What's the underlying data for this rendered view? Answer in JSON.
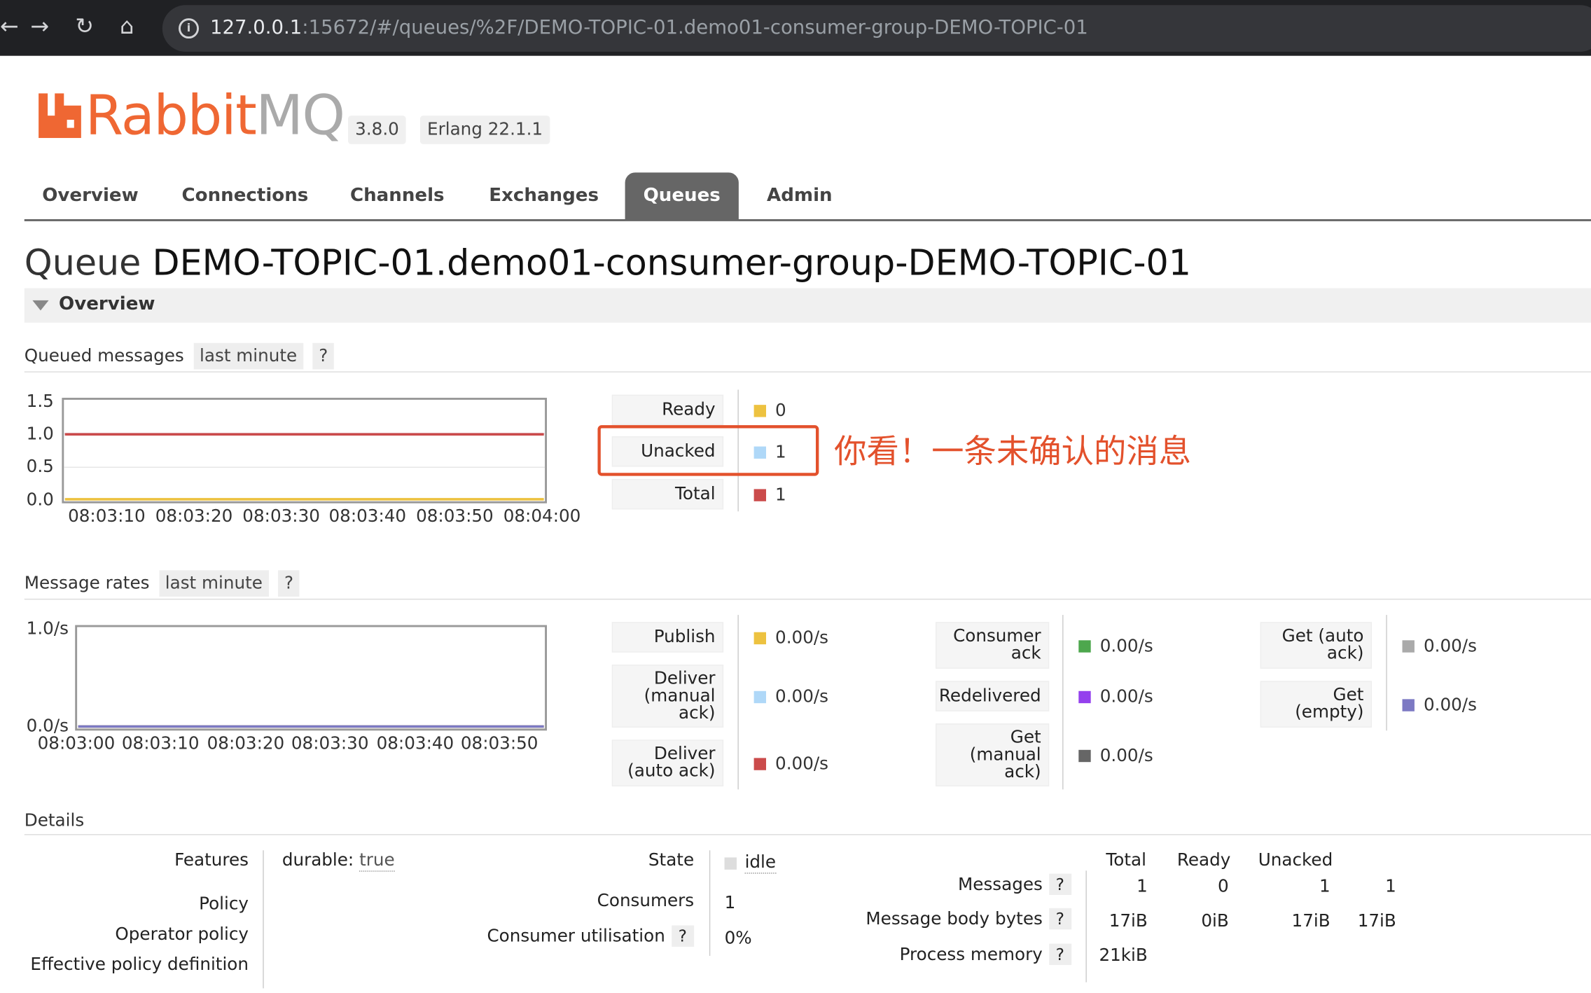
{
  "browser": {
    "url_host": "127.0.0.1",
    "url_rest": ":15672/#/queues/%2F/DEMO-TOPIC-01.demo01-consumer-group-DEMO-TOPIC-01"
  },
  "header": {
    "logo_rabbit": "Rabbit",
    "logo_mq": "MQ",
    "version": "3.8.0",
    "erlang": "Erlang 22.1.1"
  },
  "tabs": [
    "Overview",
    "Connections",
    "Channels",
    "Exchanges",
    "Queues",
    "Admin"
  ],
  "active_tab": "Queues",
  "page": {
    "title_prefix": "Queue",
    "queue_name": "DEMO-TOPIC-01.demo01-consumer-group-DEMO-TOPIC-01"
  },
  "overview_section": "Overview",
  "queued_messages": {
    "heading": "Queued messages",
    "range": "last minute",
    "help": "?",
    "y_ticks": [
      "1.5",
      "1.0",
      "0.5",
      "0.0"
    ],
    "x_ticks": [
      "08:03:10",
      "08:03:20",
      "08:03:30",
      "08:03:40",
      "08:03:50",
      "08:04:00"
    ],
    "legend": [
      {
        "label": "Ready",
        "value": "0",
        "color": "#edc240"
      },
      {
        "label": "Unacked",
        "value": "1",
        "color": "#afd8f8"
      },
      {
        "label": "Total",
        "value": "1",
        "color": "#cb4b4b"
      }
    ]
  },
  "annotation": "你看！一条未确认的消息",
  "message_rates": {
    "heading": "Message rates",
    "range": "last minute",
    "help": "?",
    "y_ticks": [
      "1.0/s",
      "0.0/s"
    ],
    "x_ticks": [
      "08:03:00",
      "08:03:10",
      "08:03:20",
      "08:03:30",
      "08:03:40",
      "08:03:50"
    ],
    "col1": [
      {
        "label": "Publish",
        "value": "0.00/s",
        "color": "#edc240"
      },
      {
        "label": "Deliver (manual ack)",
        "value": "0.00/s",
        "color": "#afd8f8"
      },
      {
        "label": "Deliver (auto ack)",
        "value": "0.00/s",
        "color": "#cb4b4b"
      }
    ],
    "col2": [
      {
        "label": "Consumer ack",
        "value": "0.00/s",
        "color": "#4da74d"
      },
      {
        "label": "Redelivered",
        "value": "0.00/s",
        "color": "#9440ed"
      },
      {
        "label": "Get (manual ack)",
        "value": "0.00/s",
        "color": "#666666"
      }
    ],
    "col3": [
      {
        "label": "Get (auto ack)",
        "value": "0.00/s",
        "color": "#aaaaaa"
      },
      {
        "label": "Get (empty)",
        "value": "0.00/s",
        "color": "#7c79c3"
      }
    ]
  },
  "chart_data": [
    {
      "type": "line",
      "title": "Queued messages",
      "x": [
        "08:03:10",
        "08:03:20",
        "08:03:30",
        "08:03:40",
        "08:03:50",
        "08:04:00"
      ],
      "ylim": [
        0,
        1.5
      ],
      "series": [
        {
          "name": "Ready",
          "color": "#edc240",
          "values": [
            0,
            0,
            0,
            0,
            0,
            0
          ]
        },
        {
          "name": "Unacked",
          "color": "#afd8f8",
          "values": [
            1,
            1,
            1,
            1,
            1,
            1
          ]
        },
        {
          "name": "Total",
          "color": "#cb4b4b",
          "values": [
            1,
            1,
            1,
            1,
            1,
            1
          ]
        }
      ]
    },
    {
      "type": "line",
      "title": "Message rates",
      "x": [
        "08:03:00",
        "08:03:10",
        "08:03:20",
        "08:03:30",
        "08:03:40",
        "08:03:50"
      ],
      "ylim": [
        0,
        1.0
      ],
      "series": [
        {
          "name": "Publish",
          "color": "#edc240",
          "values": [
            0,
            0,
            0,
            0,
            0,
            0
          ]
        },
        {
          "name": "Get (empty)",
          "color": "#7c79c3",
          "values": [
            0,
            0,
            0,
            0,
            0,
            0
          ]
        }
      ]
    }
  ],
  "details": {
    "heading": "Details",
    "features_label": "Features",
    "durable_key": "durable:",
    "durable_val": "true",
    "policy_label": "Policy",
    "operator_policy_label": "Operator policy",
    "effective_policy_label": "Effective policy definition",
    "state_label": "State",
    "state_val": "idle",
    "consumers_label": "Consumers",
    "consumers_val": "1",
    "utilisation_label": "Consumer utilisation",
    "utilisation_val": "0%",
    "help": "?",
    "col_headers": [
      "Total",
      "Ready",
      "Unacked"
    ],
    "rows": [
      {
        "label": "Messages",
        "values": [
          "1",
          "0",
          "1",
          "1"
        ]
      },
      {
        "label": "Message body bytes",
        "values": [
          "17iB",
          "0iB",
          "17iB",
          "17iB"
        ]
      },
      {
        "label": "Process memory",
        "values": [
          "21kiB"
        ]
      }
    ]
  }
}
